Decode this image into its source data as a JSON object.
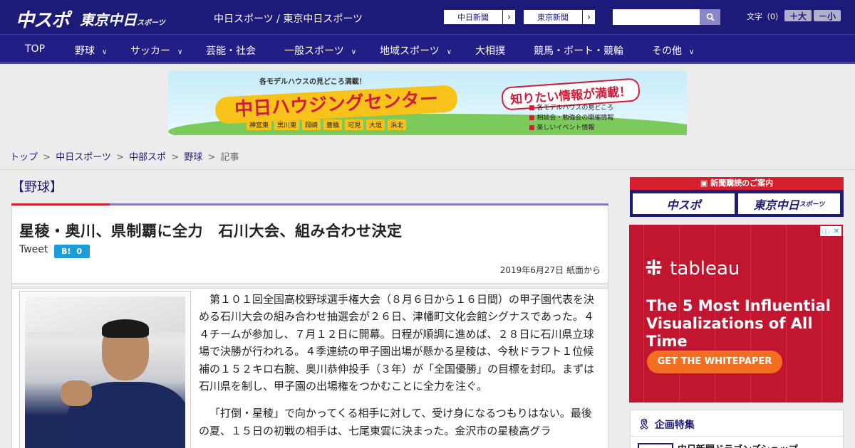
{
  "header": {
    "logo_primary": "中スポ",
    "logo_secondary": "東京中日",
    "logo_secondary_small": "スポーツ",
    "site_name": "中日スポーツ / 東京中日スポーツ",
    "paper_links": [
      {
        "label": "中日新聞",
        "arrow": "›"
      },
      {
        "label": "東京新聞",
        "arrow": "›"
      }
    ],
    "search_placeholder": "",
    "font_size_label": "文字（0）",
    "font_increase": "＋大",
    "font_decrease": "－小"
  },
  "nav": [
    {
      "label": "TOP",
      "has_menu": false
    },
    {
      "label": "野球",
      "has_menu": true
    },
    {
      "label": "サッカー",
      "has_menu": true
    },
    {
      "label": "芸能・社会",
      "has_menu": false
    },
    {
      "label": "一般スポーツ",
      "has_menu": true
    },
    {
      "label": "地域スポーツ",
      "has_menu": true
    },
    {
      "label": "大相撲",
      "has_menu": false
    },
    {
      "label": "競馬・ボート・競輪",
      "has_menu": false
    },
    {
      "label": "その他",
      "has_menu": true
    }
  ],
  "banner": {
    "tagline": "各モデルハウスの見どころ満載！",
    "title": "中日ハウジングセンター",
    "towns": [
      "神宮東",
      "黒川東",
      "岡崎",
      "豊橋",
      "可児",
      "大垣",
      "浜北"
    ],
    "ribbon": "知りたい情報が満載！",
    "bullets": [
      "各モデルハウスの見どころ",
      "相談会・勉強会の開催情報",
      "楽しいイベント情報"
    ]
  },
  "breadcrumb": {
    "items": [
      "トップ",
      "中日スポーツ",
      "中部スポ",
      "野球"
    ],
    "current": "記事",
    "separator": ">"
  },
  "article": {
    "category": "【野球】",
    "headline": "星稜・奥川、県制覇に全力　石川大会、組み合わせ決定",
    "tweet_label": "Tweet",
    "hatena_label": "B!",
    "hatena_count": "0",
    "dateline": "2019年6月27日 紙面から",
    "paragraphs": [
      "第１０１回全国高校野球選手権大会（８月６日から１６日間）の甲子園代表を決める石川大会の組み合わせ抽選会が２６日、津幡町文化会館シグナスであった。４４チームが参加し、７月１２日に開幕。日程が順調に進めば、２８日に石川県立球場で決勝が行われる。４季連続の甲子園出場が懸かる星稜は、今秋ドラフト１位候補の１５２キロ右腕、奥川恭伸投手（３年）が「全国優勝」の目標を封印。まずは石川県を制し、甲子園の出場権をつかむことに全力を注ぐ。",
      "「打倒・星稜」で向かってくる相手に対して、受け身になるつもりはない。最後の夏、１５日の初戦の相手は、七尾東雲に決まった。金沢市の星稜高グラ"
    ]
  },
  "sidebar": {
    "subscribe_header": "新聞購読のご案内",
    "subscribe_buttons": [
      "中スポ",
      "東京中日"
    ],
    "subscribe_small": "スポーツ",
    "ad": {
      "brand": "tableau",
      "headline": "The 5 Most Influential Visualizations of All Time",
      "cta": "GET THE WHITEPAPER"
    },
    "feature_title": "企画特集",
    "feature_item": "中日新聞ドラゴンズショップ"
  },
  "colors": {
    "header_bg": "#1e1a7a",
    "nav_bg": "#231e86",
    "accent_red": "#d6202f",
    "link": "#1e1a7a",
    "ad_bg": "#c2152f",
    "cta_orange": "#f26f21",
    "hatena_blue": "#1e9cd8"
  }
}
